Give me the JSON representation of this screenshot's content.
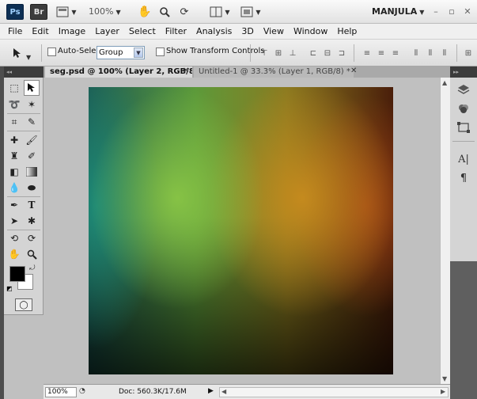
{
  "titlebar": {
    "ps_logo": "Ps",
    "br_logo": "Br",
    "zoom": "100%",
    "workspace": "MANJULA"
  },
  "menu": [
    "File",
    "Edit",
    "Image",
    "Layer",
    "Select",
    "Filter",
    "Analysis",
    "3D",
    "View",
    "Window",
    "Help"
  ],
  "options": {
    "auto_select_label": "Auto-Select:",
    "auto_select_value": "Group",
    "show_transform_label": "Show Transform Controls"
  },
  "tabs": {
    "active": "seg.psd @ 100% (Layer 2, RGB/8)",
    "inactive": "Untitled-1 @ 33.3% (Layer 1, RGB/8) *"
  },
  "status": {
    "zoom": "100%",
    "doc": "Doc: 560.3K/17.6M"
  },
  "icons": {
    "ps": "photoshop-logo",
    "br": "bridge-logo",
    "hand": "hand-icon",
    "zoom": "zoom-icon",
    "rotate": "rotate-view-icon",
    "arrange": "arrange-documents-icon",
    "screen_mode": "screen-mode-icon"
  },
  "colors": {
    "foreground": "#000000",
    "background": "#ffffff"
  }
}
